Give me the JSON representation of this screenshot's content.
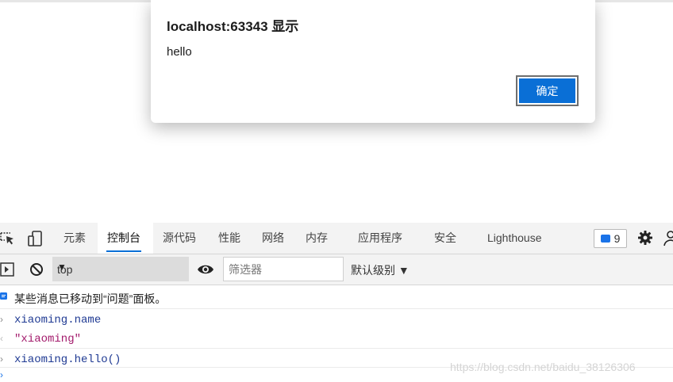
{
  "dialog": {
    "title": "localhost:63343 显示",
    "message": "hello",
    "ok_label": "确定"
  },
  "devtools": {
    "tabs": [
      "元素",
      "控制台",
      "源代码",
      "性能",
      "网络",
      "内存",
      "应用程序",
      "安全",
      "Lighthouse"
    ],
    "active_tab": "控制台",
    "issues_count": "9",
    "icons": [
      "inspect-element-icon",
      "device-toolbar-icon",
      "gear-icon",
      "user-icon",
      "sidebar-toggle-icon",
      "clear-console-icon",
      "eye-icon"
    ],
    "accent_color": "#0a6fd6"
  },
  "toolbar": {
    "context": "top",
    "filter_placeholder": "筛选器",
    "level": "默认级别 ▼"
  },
  "console": {
    "info_message": "某些消息已移动到“问题”面板。",
    "lines": [
      {
        "type": "input",
        "text": "xiaoming.name"
      },
      {
        "type": "output",
        "text": "\"xiaoming\""
      },
      {
        "type": "input",
        "text": "xiaoming.hello()"
      }
    ]
  },
  "watermark": "https://blog.csdn.net/baidu_38126306"
}
